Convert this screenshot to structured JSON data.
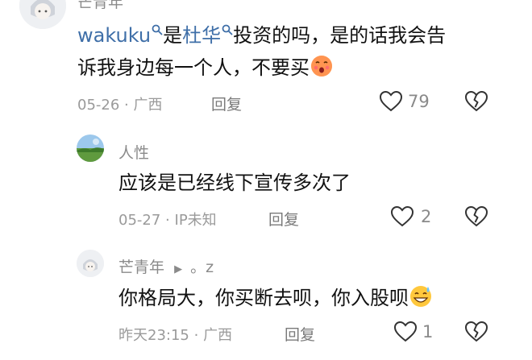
{
  "comments": [
    {
      "author": "芒青年",
      "mention1": "wakuku",
      "connector1": "是",
      "mention2": "杜华",
      "text_line1_rest": "投资的吗，是的话我会告",
      "text_line2": "诉我身边每一个人，不要买",
      "date": "05-26",
      "location": "广西",
      "reply_label": "回复",
      "likes": "79",
      "emoji": "kissing-face-emoji"
    },
    {
      "author": "人性",
      "text": "应该是已经线下宣传多次了",
      "date": "05-27",
      "location": "IP未知",
      "reply_label": "回复",
      "likes": "2"
    },
    {
      "author": "芒青年",
      "reply_marker": "▶",
      "reply_to": "。z",
      "text": "你格局大，你买断去呗，你入股呗",
      "date": "昨天23:15",
      "location": "广西",
      "reply_label": "回复",
      "likes": "1",
      "emoji": "grinning-sweat-emoji"
    }
  ],
  "separator": "·",
  "colors": {
    "mention": "#3f6fa8",
    "meta": "#9a9a9a",
    "text": "#111111"
  }
}
